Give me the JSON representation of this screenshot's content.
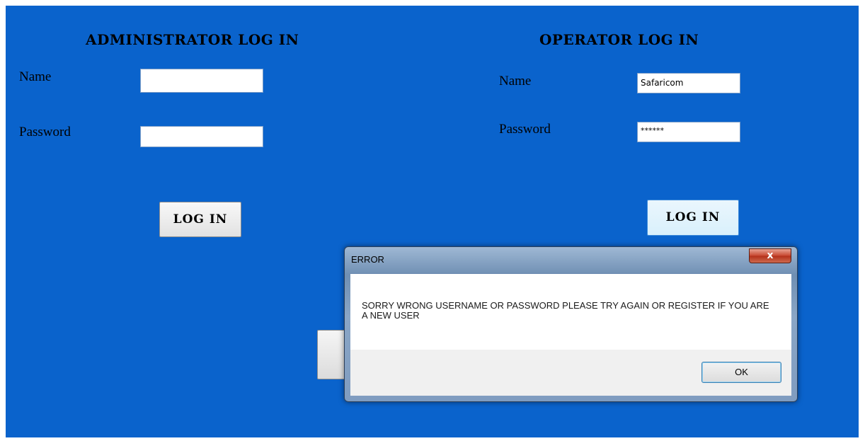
{
  "admin": {
    "title": "ADMINISTRATOR LOG IN",
    "name_label": "Name",
    "name_value": "",
    "password_label": "Password",
    "password_value": "",
    "login_label": "LOG IN"
  },
  "operator": {
    "title": "OPERATOR LOG IN",
    "name_label": "Name",
    "name_value": "Safaricom",
    "password_label": "Password",
    "password_value": "******",
    "login_label": "LOG IN"
  },
  "dialog": {
    "title": "ERROR",
    "close_label": "x",
    "message": "SORRY WRONG USERNAME OR PASSWORD PLEASE TRY AGAIN OR REGISTER IF YOU ARE A NEW USER",
    "ok_label": "OK"
  },
  "colors": {
    "background": "#0a63cc",
    "dialog_frame": "#7f9cc0",
    "close_button": "#c7462f"
  }
}
